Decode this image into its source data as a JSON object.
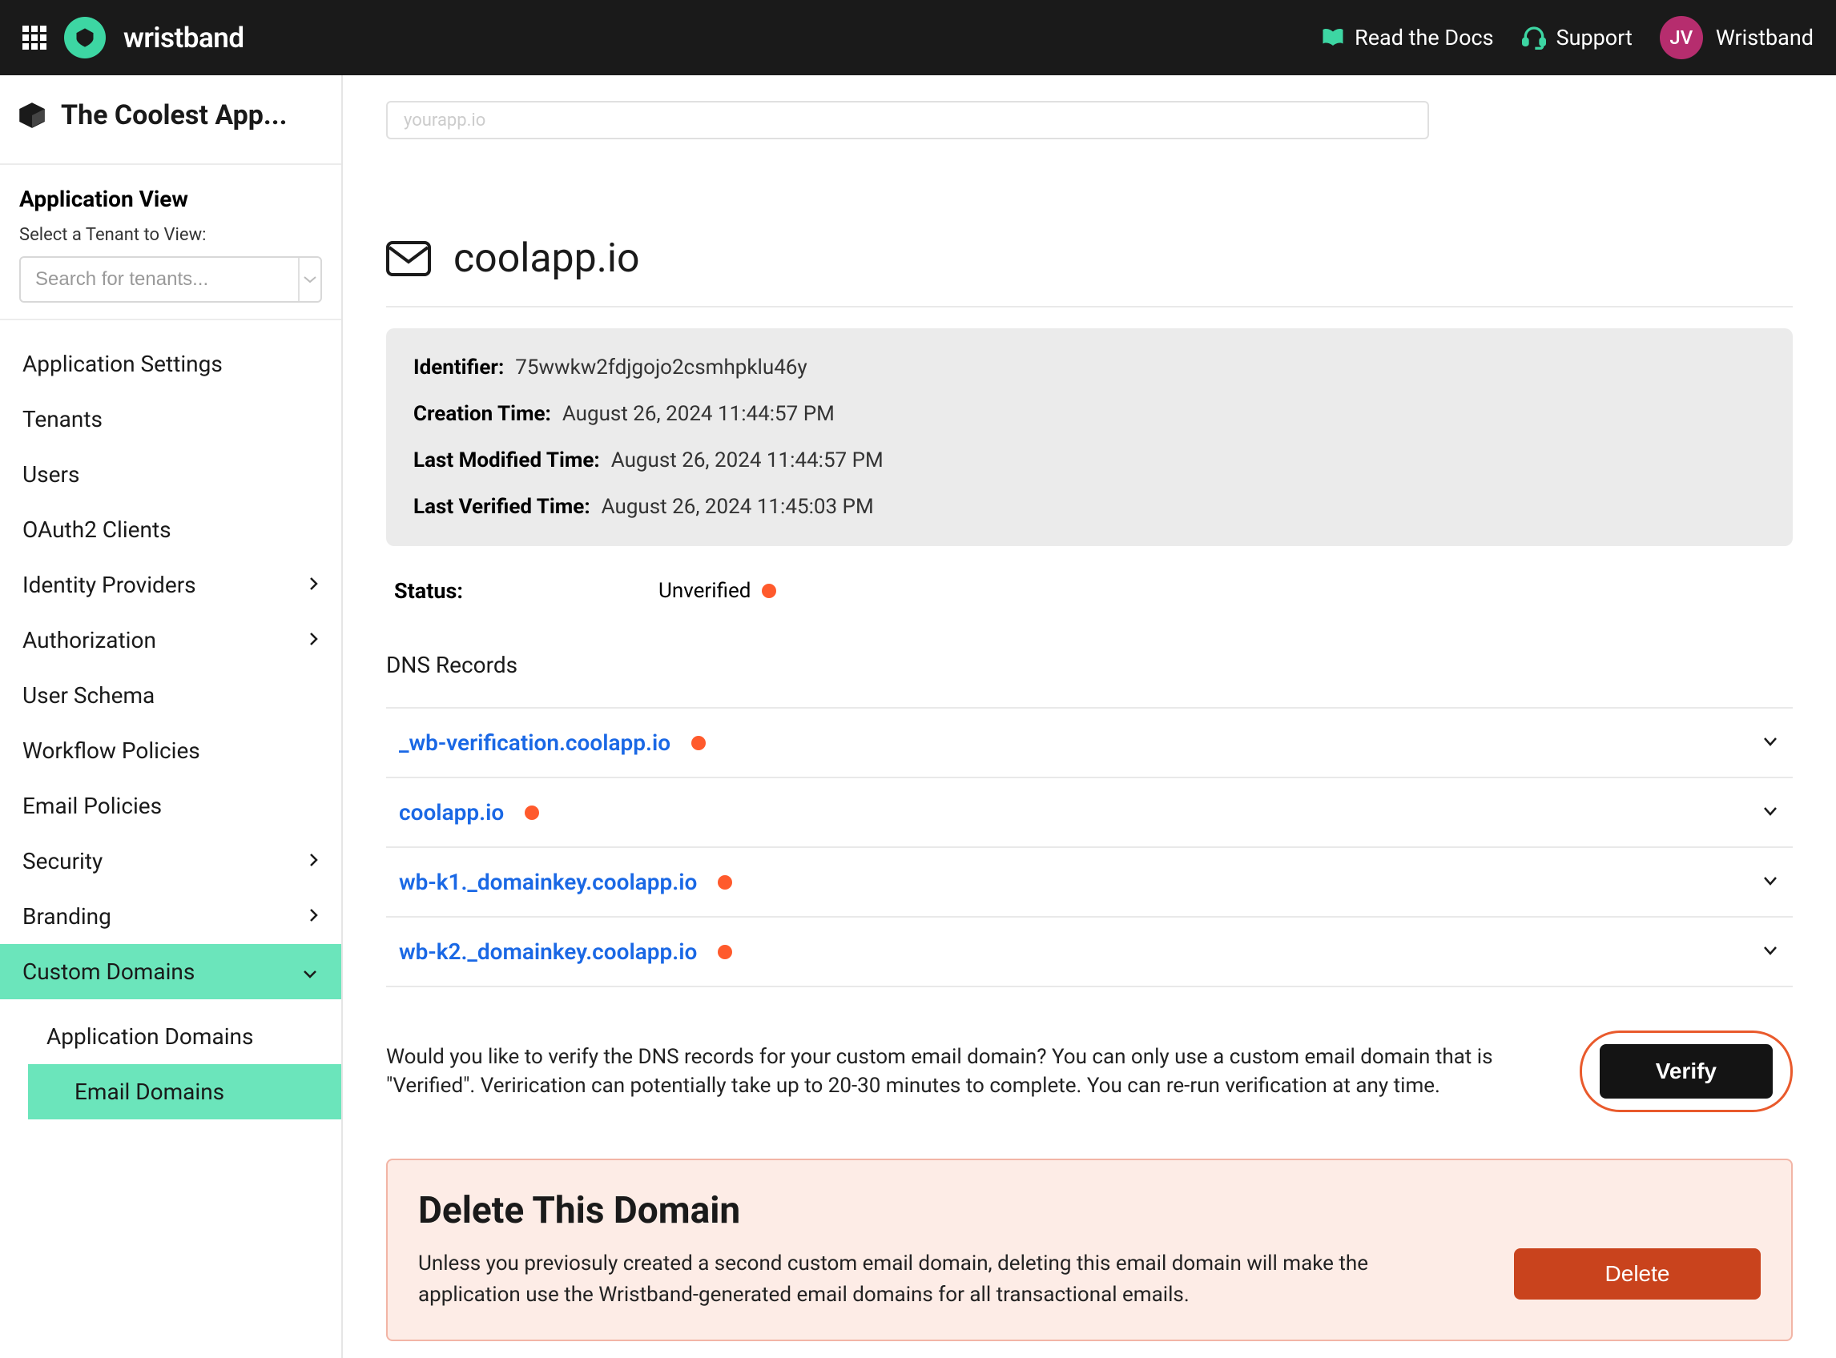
{
  "topbar": {
    "brand": "wristband",
    "docs_label": "Read the Docs",
    "support_label": "Support",
    "avatar_initials": "JV",
    "avatar_name": "Wristband"
  },
  "sidebar": {
    "app_title": "The Coolest App...",
    "view_heading": "Application View",
    "view_sub": "Select a Tenant to View:",
    "search_placeholder": "Search for tenants...",
    "items": [
      {
        "label": "Application Settings",
        "expand": false
      },
      {
        "label": "Tenants",
        "expand": false
      },
      {
        "label": "Users",
        "expand": false
      },
      {
        "label": "OAuth2 Clients",
        "expand": false
      },
      {
        "label": "Identity Providers",
        "expand": true
      },
      {
        "label": "Authorization",
        "expand": true
      },
      {
        "label": "User Schema",
        "expand": false
      },
      {
        "label": "Workflow Policies",
        "expand": false
      },
      {
        "label": "Email Policies",
        "expand": false
      },
      {
        "label": "Security",
        "expand": true
      },
      {
        "label": "Branding",
        "expand": true
      },
      {
        "label": "Custom Domains",
        "expand": true,
        "expanded": true
      }
    ],
    "subitems": [
      {
        "label": "Application Domains"
      },
      {
        "label": "Email Domains",
        "active": true
      }
    ]
  },
  "url_value": "yourapp.io",
  "domain": {
    "title": "coolapp.io",
    "identifier_label": "Identifier:",
    "identifier_value": "75wwkw2fdjgojo2csmhpklu46y",
    "creation_label": "Creation Time:",
    "creation_value": "August 26, 2024 11:44:57 PM",
    "modified_label": "Last Modified Time:",
    "modified_value": "August 26, 2024 11:44:57 PM",
    "verified_label": "Last Verified Time:",
    "verified_value": "August 26, 2024 11:45:03 PM",
    "status_label": "Status:",
    "status_value": "Unverified"
  },
  "dns": {
    "title": "DNS Records",
    "records": [
      {
        "name": "_wb-verification.coolapp.io"
      },
      {
        "name": "coolapp.io"
      },
      {
        "name": "wb-k1._domainkey.coolapp.io"
      },
      {
        "name": "wb-k2._domainkey.coolapp.io"
      }
    ]
  },
  "verify": {
    "text": "Would you like to verify the DNS records for your custom email domain? You can only use a custom email domain that is \"Verified\". Verirication can potentially take up to 20-30 minutes to complete. You can re-run verification at any time.",
    "button": "Verify"
  },
  "delete": {
    "title": "Delete This Domain",
    "text": "Unless you previosuly created a second custom email domain, deleting this email domain will make the application use the Wristband-generated email domains for all transactional emails.",
    "button": "Delete"
  }
}
